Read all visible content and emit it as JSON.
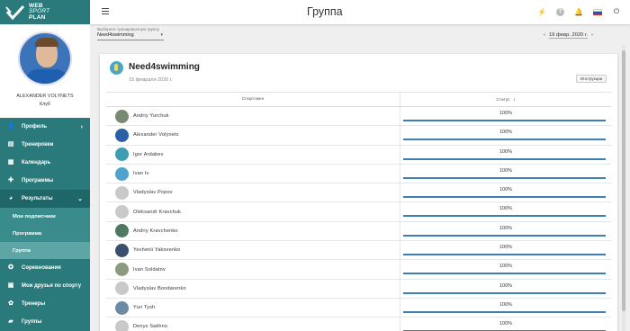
{
  "app": {
    "logo_lines": [
      "WEB",
      "SPORT",
      "PLAN"
    ],
    "page_title": "Группа"
  },
  "profile": {
    "name": "ALEXANDER VOLYNETS",
    "role": "Клуб"
  },
  "sidebar": {
    "items": [
      {
        "label": "Профиль",
        "icon": "user-icon",
        "chevron": "›"
      },
      {
        "label": "Тренировки",
        "icon": "clipboard-icon"
      },
      {
        "label": "Календарь",
        "icon": "calendar-icon"
      },
      {
        "label": "Программы",
        "icon": "puzzle-icon"
      },
      {
        "label": "Результаты",
        "icon": "pie-chart-icon",
        "chevron": "⌄"
      },
      {
        "label": "Соревнования",
        "icon": "trophy-icon"
      },
      {
        "label": "Мои друзья по спорту",
        "icon": "contacts-icon"
      },
      {
        "label": "Тренеры",
        "icon": "coach-icon"
      },
      {
        "label": "Группы",
        "icon": "folder-icon"
      }
    ],
    "sub_items": [
      {
        "label": "Мои подписчики"
      },
      {
        "label": "Программа"
      },
      {
        "label": "Группа"
      }
    ]
  },
  "filters": {
    "group_label": "Выберите тренировочную группу",
    "group_value": "Need4swimming",
    "date_value": "19 февр. 2020 г.",
    "prev": "‹",
    "next": "›"
  },
  "card": {
    "group_name": "Need4swimming",
    "date": "19 февраля 2020 г.",
    "results_button": "Инструкции"
  },
  "table": {
    "col_athlete": "Спортсмен",
    "col_status": "Статус",
    "rows": [
      {
        "name": "Andriy Yurchuk",
        "status": "100%",
        "progress": 1.0,
        "avatar_color": "#7a8a70"
      },
      {
        "name": "Alexander Volynets",
        "status": "100%",
        "progress": 1.0,
        "avatar_color": "#2b5fa8"
      },
      {
        "name": "Igor Ardabev",
        "status": "100%",
        "progress": 1.0,
        "avatar_color": "#3e9cb4"
      },
      {
        "name": "Ivan Iv",
        "status": "100%",
        "progress": 1.0,
        "avatar_color": "#4fa2cc"
      },
      {
        "name": "Vladyslav Popov",
        "status": "100%",
        "progress": 1.0,
        "avatar_color": "#c9c9c9"
      },
      {
        "name": "Oleksandr Kravchuk",
        "status": "100%",
        "progress": 1.0,
        "avatar_color": "#c9c9c9"
      },
      {
        "name": "Andriy Kravchenko",
        "status": "100%",
        "progress": 1.0,
        "avatar_color": "#4b7a60"
      },
      {
        "name": "Yevhenii Yakovenko",
        "status": "100%",
        "progress": 1.0,
        "avatar_color": "#3a4f6e"
      },
      {
        "name": "Ivan Soldatov",
        "status": "100%",
        "progress": 1.0,
        "avatar_color": "#8a9a80"
      },
      {
        "name": "Vladyslav Bondarenko",
        "status": "100%",
        "progress": 1.0,
        "avatar_color": "#c9c9c9"
      },
      {
        "name": "Yuri Tysh",
        "status": "100%",
        "progress": 1.0,
        "avatar_color": "#6b8aa3"
      },
      {
        "name": "Denys Sakhno",
        "status": "100%",
        "progress": 1.0,
        "avatar_color": "#c9c9c9"
      }
    ]
  },
  "colors": {
    "sidebar": "#2a7a7b",
    "accent_bar": "#3d7fb0"
  }
}
